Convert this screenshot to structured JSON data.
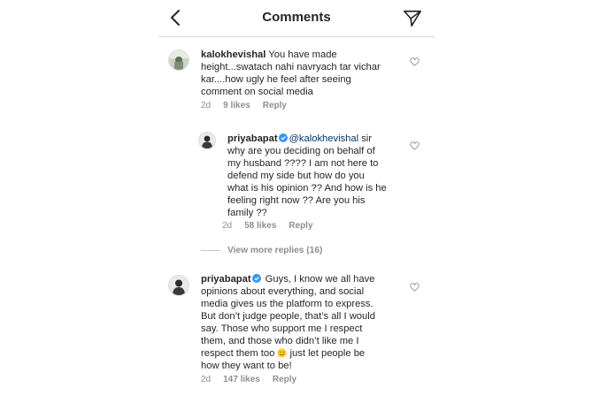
{
  "header": {
    "title": "Comments",
    "back_icon": "chevron-left-icon",
    "share_icon": "send-paper-plane-icon"
  },
  "comments": [
    {
      "username": "kalokhevishal",
      "text_line1": " You have made",
      "text_line2": "height...swatach nahi navryach tar vichar",
      "text_line3": "kar....how ugly he feel after seeing",
      "text_line4": "comment on social media",
      "age": "2d",
      "likes": "9 likes",
      "reply": "Reply"
    },
    {
      "username": "priyabapat",
      "mention": "@kalokhevishal",
      "text_line1": " sir",
      "text_line2": "why are you deciding on behalf of",
      "text_line3": "my husband ???? I am not here to",
      "text_line4": "defend my side but how do you",
      "text_line5": "what is his opinion ?? And how is he",
      "text_line6": "feeling right now ?? Are you his",
      "text_line7": "family ??",
      "age": "2d",
      "likes": "58 likes",
      "reply": "Reply"
    },
    {
      "username": "priyabapat",
      "text_line1": " Guys, I know we all have",
      "text_line2": "opinions about everything, and social",
      "text_line3": "media gives us the platform to express.",
      "text_line4": "But don’t judge people, that’s all I would",
      "text_line5": "say. Those who support me I respect",
      "text_line6": "them, and those who didn’t like me I",
      "text_line7a": "respect them too ",
      "text_line7b": " just let people be",
      "text_line8": "how they want to be!",
      "age": "2d",
      "likes": "147 likes",
      "reply": "Reply"
    }
  ],
  "view_more_replies": "View more replies (16)",
  "icons": {
    "like": "heart-outline-icon",
    "verified": "verified-badge-icon",
    "emoji": "smiling-face-emoji-icon"
  },
  "colors": {
    "verified": "#3897f0",
    "mention": "#003569",
    "muted": "#8e8e8e",
    "text": "#262626",
    "divider": "#dbdbdb"
  }
}
